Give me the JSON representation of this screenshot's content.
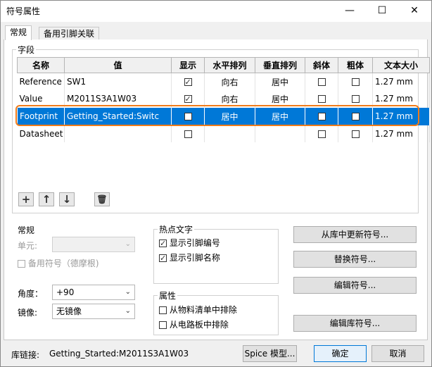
{
  "window": {
    "title": "符号属性",
    "minimize_glyph": "—",
    "maximize_glyph": "☐",
    "close_glyph": "✕"
  },
  "tabs": [
    {
      "label": "常规",
      "active": true
    },
    {
      "label": "备用引脚关联",
      "active": false
    }
  ],
  "fields": {
    "group_label": "字段",
    "columns": [
      "名称",
      "值",
      "显示",
      "水平排列",
      "垂直排列",
      "斜体",
      "粗体",
      "文本大小"
    ],
    "rows": [
      {
        "name": "Reference",
        "value": "SW1",
        "show": true,
        "h_align": "向右",
        "v_align": "居中",
        "italic": false,
        "bold": false,
        "text_size": "1.27 mm",
        "selected": false
      },
      {
        "name": "Value",
        "value": "M2011S3A1W03",
        "show": true,
        "h_align": "向右",
        "v_align": "居中",
        "italic": false,
        "bold": false,
        "text_size": "1.27 mm",
        "selected": false
      },
      {
        "name": "Footprint",
        "value": "Getting_Started:Switc",
        "show": false,
        "h_align": "居中",
        "v_align": "居中",
        "italic": false,
        "bold": false,
        "text_size": "1.27 mm",
        "selected": true
      },
      {
        "name": "Datasheet",
        "value": "",
        "show": false,
        "h_align": "",
        "v_align": "",
        "italic": false,
        "bold": false,
        "text_size": "1.27 mm",
        "selected": false
      }
    ],
    "toolbar_icons": [
      "plus-icon",
      "arrow-up-icon",
      "arrow-down-icon",
      "trash-icon"
    ],
    "toolbar_glyphs": {
      "add": "+",
      "up": "↑",
      "down": "↓",
      "delete": "🗑"
    }
  },
  "general": {
    "group_label": "常规",
    "unit_label": "单元:",
    "unit_value": "",
    "alternate_symbol_label": "备用符号（德摩根)",
    "alternate_symbol_checked": false,
    "angle_label": "角度：",
    "angle_value": "+90",
    "mirror_label": "镜像:",
    "mirror_value": "无镜像",
    "dropdown_glyph": "⌄"
  },
  "hotspot_text": {
    "group_label": "热点文字",
    "show_pin_numbers": {
      "label": "显示引脚编号",
      "checked": true
    },
    "show_pin_names": {
      "label": "显示引脚名称",
      "checked": true
    }
  },
  "attributes": {
    "group_label": "属性",
    "exclude_from_bom": {
      "label": "从物料清单中排除",
      "checked": false
    },
    "exclude_from_board": {
      "label": "从电路板中排除",
      "checked": false
    }
  },
  "actions": {
    "update_from_library": "从库中更新符号...",
    "change_symbol": "替换符号...",
    "edit_symbol": "编辑符号...",
    "edit_library_symbol": "编辑库符号..."
  },
  "footer": {
    "library_link_label": "库链接:",
    "library_link_value": "Getting_Started:M2011S3A1W03",
    "spice_model_button": "Spice 模型...",
    "ok_button": "确定",
    "cancel_button": "取消"
  },
  "colors": {
    "selection": "#0078d7",
    "highlight_outline": "#f07b1a"
  }
}
